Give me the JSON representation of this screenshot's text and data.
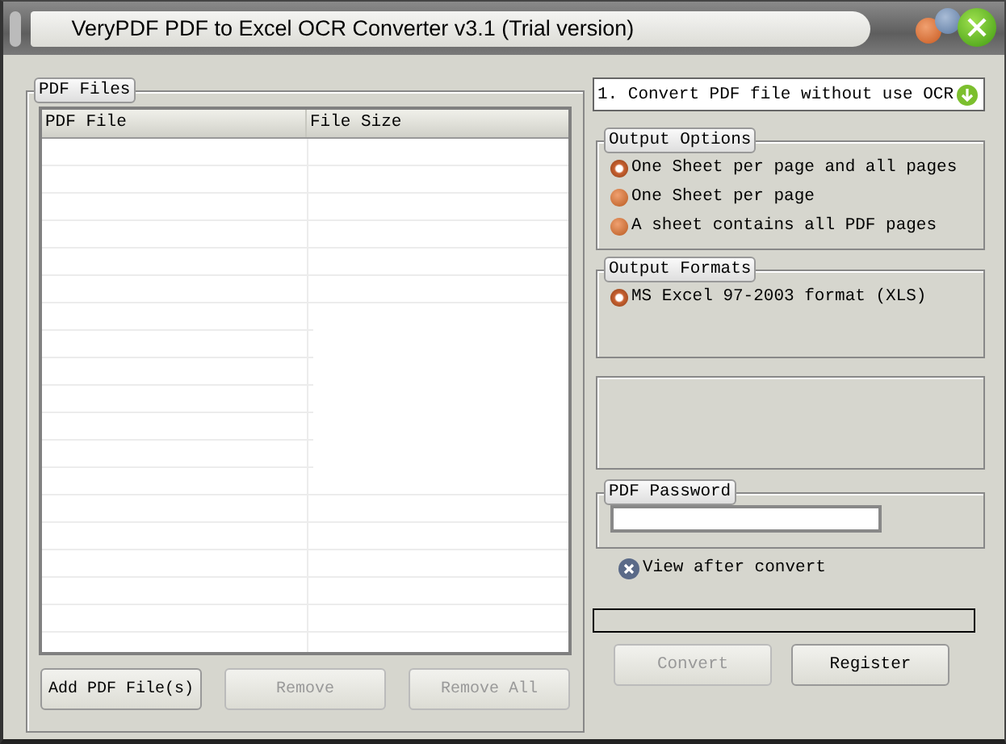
{
  "window": {
    "title": "VeryPDF PDF to Excel OCR Converter v3.1 (Trial version)"
  },
  "pdf_files": {
    "title": "PDF Files",
    "columns": [
      "PDF File",
      "File Size"
    ],
    "buttons": [
      {
        "label": "Add PDF File(s)",
        "disabled": false
      },
      {
        "label": "Remove",
        "disabled": true
      },
      {
        "label": "Remove All",
        "disabled": true
      }
    ]
  },
  "mode": {
    "value": "1. Convert PDF file without use OCR"
  },
  "output_options": {
    "title": "Output Options",
    "options": [
      {
        "label": "One Sheet per page and all pages",
        "selected": true
      },
      {
        "label": "One Sheet per page",
        "selected": false
      },
      {
        "label": "A sheet contains all PDF pages",
        "selected": false
      }
    ]
  },
  "output_formats": {
    "title": "Output Formats",
    "options": [
      {
        "label": "MS Excel 97-2003 format (XLS)",
        "selected": true
      }
    ]
  },
  "pdf_password": {
    "title": "PDF Password"
  },
  "view_after_convert": {
    "label": "View after convert"
  },
  "actions": [
    {
      "label": "Convert",
      "disabled": true
    },
    {
      "label": "Register",
      "disabled": false
    }
  ]
}
